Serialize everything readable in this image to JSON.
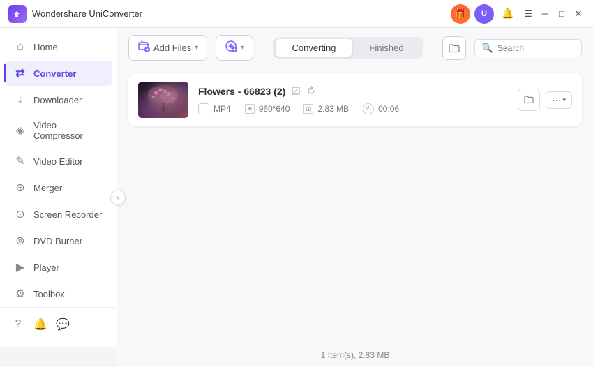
{
  "app": {
    "name": "Wondershare UniConverter"
  },
  "titlebar": {
    "controls": {
      "gift_label": "🎁",
      "user_label": "U",
      "bell_label": "🔔",
      "menu_label": "☰",
      "minimize_label": "─",
      "maximize_label": "□",
      "close_label": "✕"
    }
  },
  "sidebar": {
    "items": [
      {
        "id": "home",
        "label": "Home",
        "icon": "⌂"
      },
      {
        "id": "converter",
        "label": "Converter",
        "icon": "⇄",
        "active": true
      },
      {
        "id": "downloader",
        "label": "Downloader",
        "icon": "↓"
      },
      {
        "id": "video-compressor",
        "label": "Video Compressor",
        "icon": "◈"
      },
      {
        "id": "video-editor",
        "label": "Video Editor",
        "icon": "✎"
      },
      {
        "id": "merger",
        "label": "Merger",
        "icon": "⊕"
      },
      {
        "id": "screen-recorder",
        "label": "Screen Recorder",
        "icon": "⊙"
      },
      {
        "id": "dvd-burner",
        "label": "DVD Burner",
        "icon": "⊚"
      },
      {
        "id": "player",
        "label": "Player",
        "icon": "▶"
      },
      {
        "id": "toolbox",
        "label": "Toolbox",
        "icon": "⚙"
      }
    ],
    "bottom_icons": [
      "?",
      "🔔",
      "💬"
    ]
  },
  "toolbar": {
    "add_file_label": "Add Files",
    "add_vr_label": "",
    "folder_icon": "🗁",
    "tab_converting": "Converting",
    "tab_finished": "Finished",
    "search_placeholder": "Search"
  },
  "file_list": {
    "items": [
      {
        "name": "Flowers - 66823 (2)",
        "format": "MP4",
        "resolution": "960*640",
        "size": "2.83 MB",
        "duration": "00:06"
      }
    ]
  },
  "status_bar": {
    "text": "1 Item(s), 2.83 MB"
  },
  "collapse": {
    "icon": "‹"
  }
}
